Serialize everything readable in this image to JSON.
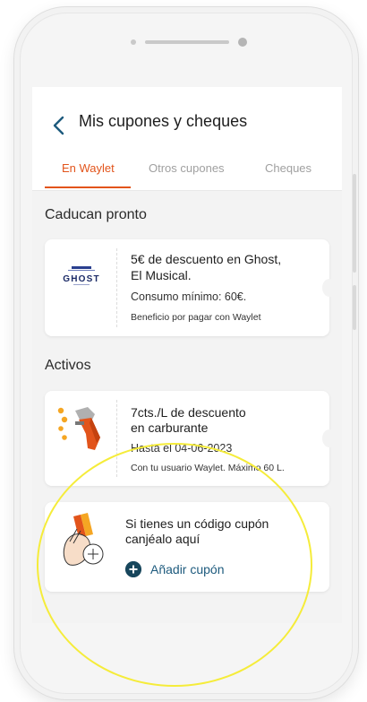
{
  "header": {
    "title": "Mis cupones y cheques",
    "tabs": [
      {
        "label": "En Waylet",
        "active": true
      },
      {
        "label": "Otros cupones",
        "active": false
      },
      {
        "label": "Cheques",
        "active": false
      }
    ]
  },
  "sections": {
    "expiring": "Caducan pronto",
    "active": "Activos"
  },
  "expiring_coupon": {
    "logo_text": "GHOST",
    "title_line1": "5€ de descuento en Ghost,",
    "title_line2": "El Musical.",
    "condition": "Consumo mínimo: 60€.",
    "note": "Beneficio por pagar con Waylet"
  },
  "active_coupon": {
    "title_line1": "7cts./L de descuento",
    "title_line2": "en carburante",
    "validity": "Hasta el 04-06-2023",
    "note": "Con tu usuario Waylet. Máximo 60 L."
  },
  "redeem": {
    "title_line1": "Si tienes un código cupón",
    "title_line2": "canjéalo aquí",
    "button_label": "Añadir cupón"
  },
  "colors": {
    "accent": "#e2541b",
    "button_dark": "#17465c",
    "link": "#1d5a7d",
    "highlight": "#f5ec3a"
  }
}
